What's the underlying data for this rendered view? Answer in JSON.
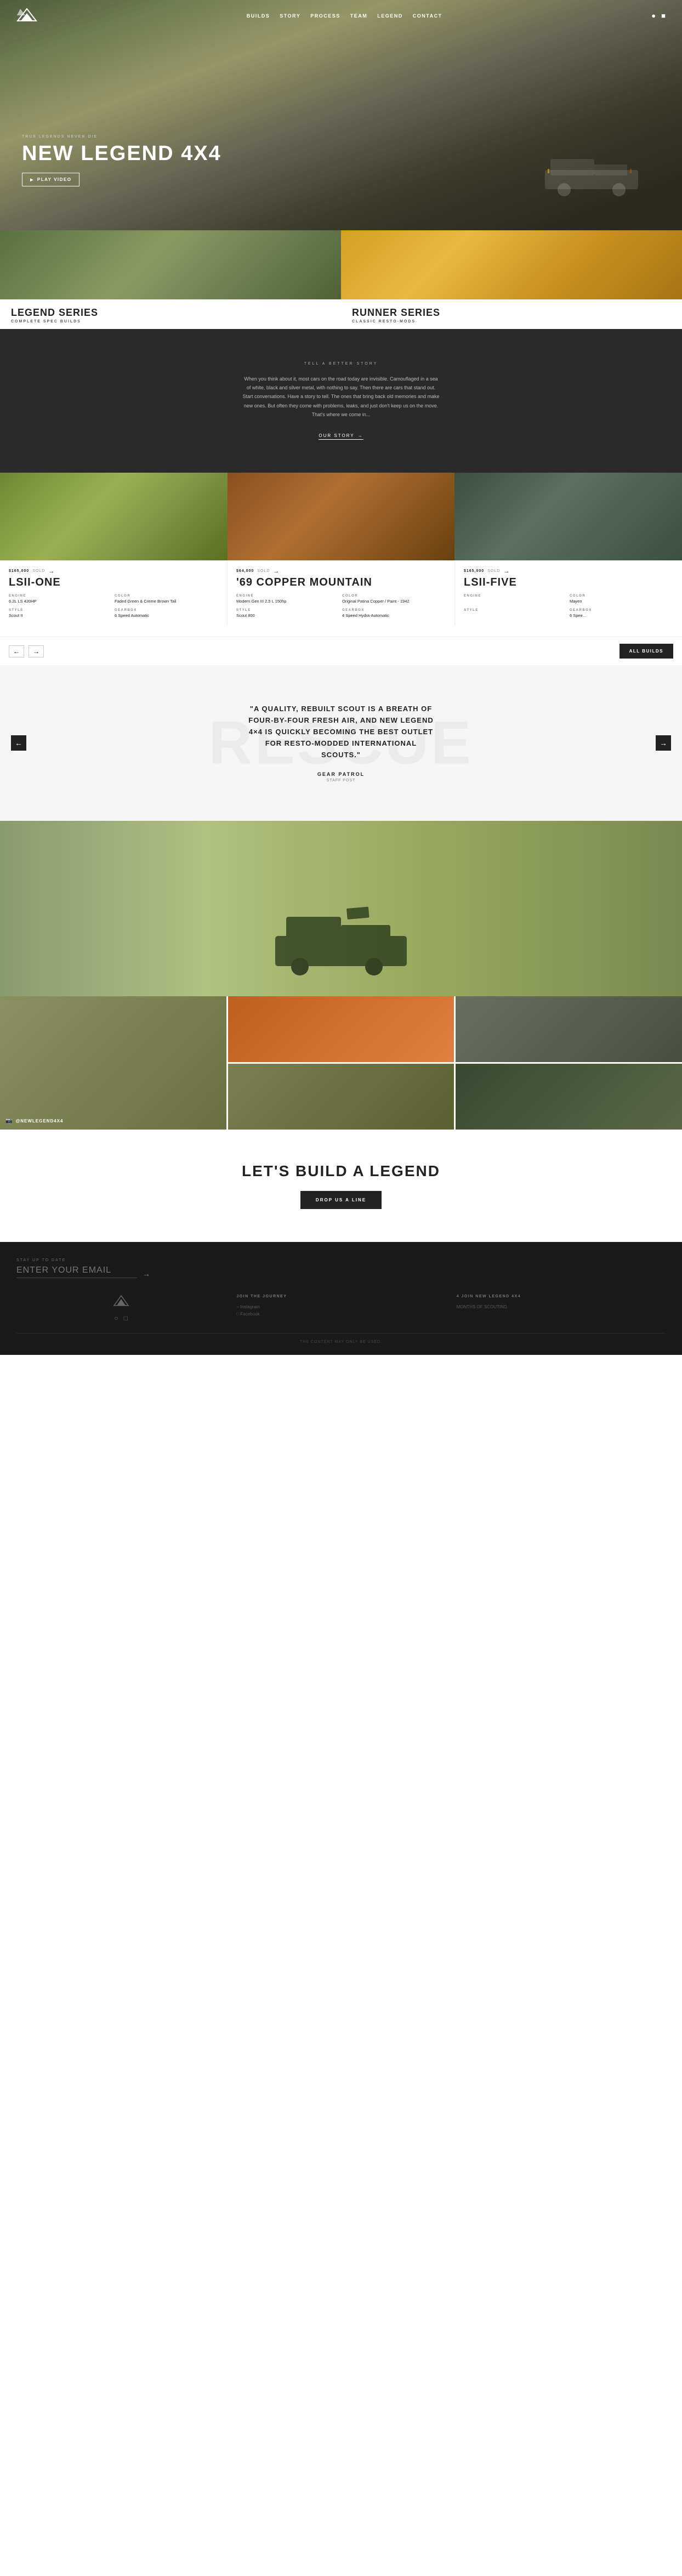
{
  "nav": {
    "links": [
      "BUILDS",
      "STORY",
      "PROCESS",
      "TEAM",
      "LEGEND",
      "CONTACT"
    ],
    "logo_alt": "New Legend 4x4 Logo"
  },
  "hero": {
    "eyebrow": "TRUE LEGENDS NEVER DIE",
    "title": "NEW LEGEND 4X4",
    "play_btn": "PLAY VIDEO"
  },
  "series": [
    {
      "id": "legend",
      "name": "LEGEND SERIES",
      "sub": "COMPLETE SPEC BUILDS"
    },
    {
      "id": "runner",
      "name": "RUNNER SERIES",
      "sub": "CLASSIC RESTO-MODS"
    }
  ],
  "story": {
    "eyebrow": "TELL A BETTER STORY",
    "title": "TELL A BETTER STORY",
    "body": "When you think about it, most cars on the road today are invisible. Camouflaged in a sea of white, black and silver metal, with nothing to say. Then there are cars that stand out. Start conversations. Have a story to tell. The ones that bring back old memories and make new ones. But often they come with problems, leaks, and just don't keep us on the move. That's where we come in...",
    "link": "OUR STORY"
  },
  "builds": {
    "cards": [
      {
        "price": "$165,000",
        "status": "SOLD",
        "name": "LSII-ONE",
        "engine_label": "ENGINE",
        "engine_val": "6.2L LS 420HP",
        "color_label": "COLOR",
        "color_val": "Faded Green & Creme Brown Tail",
        "style_label": "STYLE",
        "style_val": "Scout II",
        "gearbox_label": "GEARBOX",
        "gearbox_val": "6 Speed Automatic"
      },
      {
        "price": "$64,000",
        "status": "SOLD",
        "name": "'69 COPPER MOUNTAIN",
        "engine_label": "ENGINE",
        "engine_val": "Modern Gen III 2.5 L 150hp",
        "color_label": "COLOR",
        "color_val": "Original Patina Copper / Paint - 1942",
        "style_label": "STYLE",
        "style_val": "Scout 800",
        "gearbox_label": "GEARBOX",
        "gearbox_val": "4 Speed Hydra-Automatic"
      },
      {
        "price": "$165,000",
        "status": "SOLD",
        "name": "LSII-FIVE",
        "engine_label": "ENGINE",
        "engine_val": "",
        "color_label": "COLOR",
        "color_val": "Mayen",
        "style_label": "STYLE",
        "style_val": "",
        "gearbox_label": "GEARBOX",
        "gearbox_val": "6 Spee..."
      }
    ],
    "all_builds_btn": "ALL BUILDS",
    "prev_label": "←",
    "next_label": "→"
  },
  "quote": {
    "bg_text": "RESCUE",
    "text": "\"A QUALITY, REBUILT SCOUT IS A BREATH OF FOUR-BY-FOUR FRESH AIR, AND NEW LEGEND 4×4 IS QUICKLY BECOMING THE BEST OUTLET FOR RESTO-MODDED INTERNATIONAL SCOUTS.\"",
    "source_name": "GEAR PATROL",
    "source_role": "Staff Post"
  },
  "lifestyle": {
    "instagram_handle": "@NEWLEGEND4X4"
  },
  "cta": {
    "title": "LET'S BUILD A LEGEND",
    "btn": "DROP US A LINE"
  },
  "footer": {
    "email_label": "STAY UP TO DATE",
    "email_placeholder": "ENTER YOUR EMAIL",
    "col1": {
      "title": "",
      "logo_alt": "New Legend 4x4"
    },
    "col2": {
      "title": "JOIN THE JOURNEY",
      "social": [
        "Instagram",
        "Facebook"
      ]
    },
    "col3": {
      "title": "4 JOIN NEW LEGEND 4X4",
      "text": "MONTHS OF SCOUTING"
    },
    "bottom": "THE CONTENT MAY ONLY BE USED."
  }
}
